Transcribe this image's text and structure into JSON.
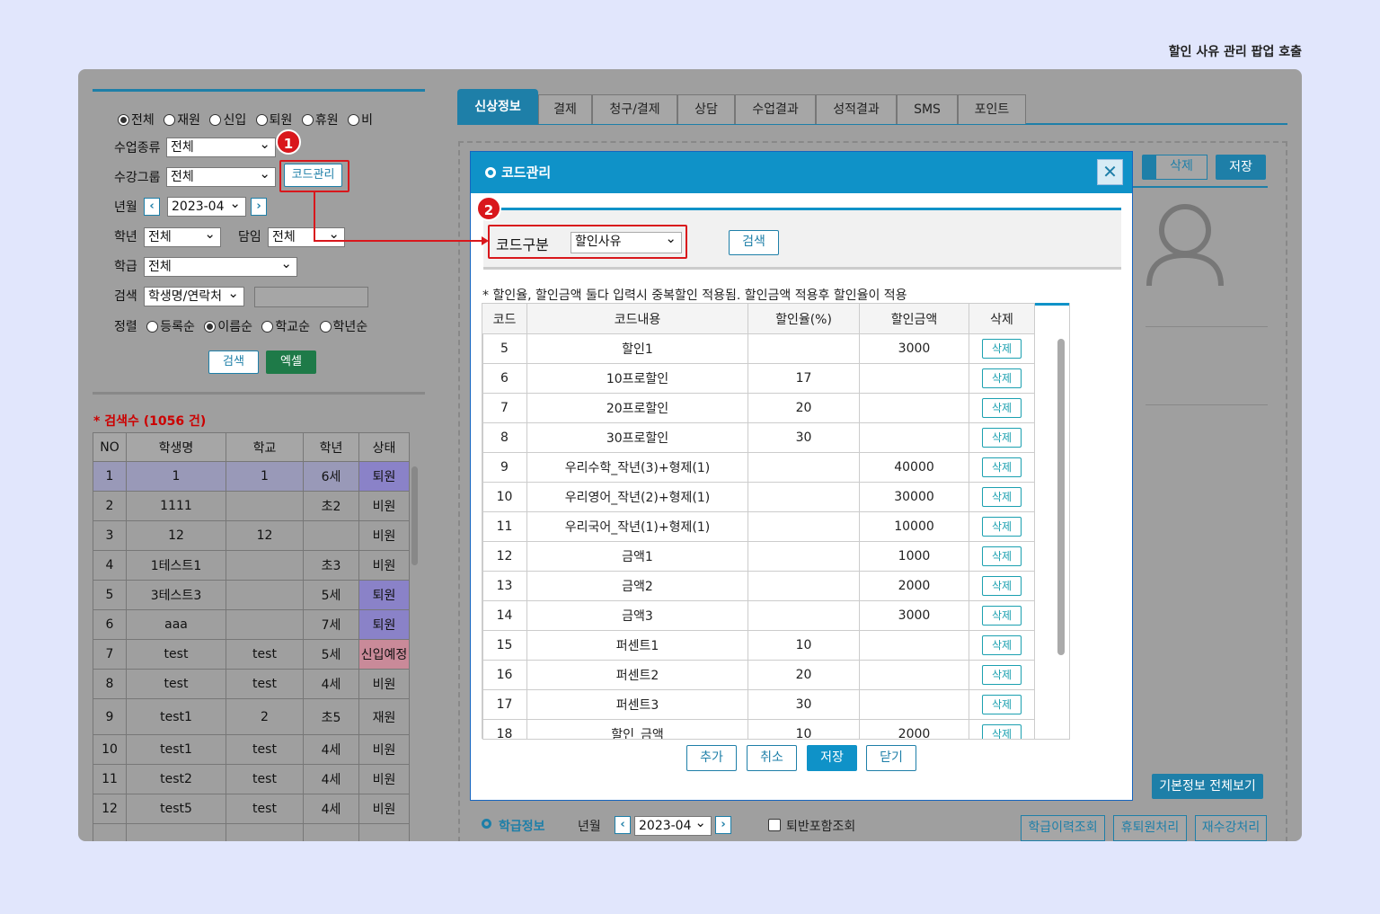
{
  "caption": "할인 사유 관리 팝업 호출",
  "left": {
    "radios": [
      "전체",
      "재원",
      "신입",
      "퇴원",
      "휴원",
      "비"
    ],
    "class_type_label": "수업종류",
    "class_type_value": "전체",
    "group_label": "수강그룹",
    "group_value": "전체",
    "code_btn": "코드관리",
    "ym_label": "년월",
    "ym_value": "2023-04",
    "grade_label": "학년",
    "grade_value": "전체",
    "teacher_label": "담임",
    "teacher_value": "전체",
    "school_label": "학급",
    "school_value": "전체",
    "search_label": "검색",
    "search_type": "학생명/연락처",
    "sort_label": "정렬",
    "sort_opts": [
      "등록순",
      "이름순",
      "학교순",
      "학년순"
    ],
    "search_btn": "검색",
    "excel_btn": "엑셀",
    "count": "* 검색수 (1056 건)",
    "headers": [
      "NO",
      "학생명",
      "학교",
      "학년",
      "상태"
    ],
    "rows": [
      [
        "1",
        "1",
        "1",
        "6세",
        "퇴원"
      ],
      [
        "2",
        "1111",
        "",
        "초2",
        "비원"
      ],
      [
        "3",
        "12",
        "12",
        "",
        "비원"
      ],
      [
        "4",
        "1테스트1",
        "",
        "초3",
        "비원"
      ],
      [
        "5",
        "3테스트3",
        "",
        "5세",
        "퇴원"
      ],
      [
        "6",
        "aaa",
        "",
        "7세",
        "퇴원"
      ],
      [
        "7",
        "test",
        "test",
        "5세",
        "신입예정"
      ],
      [
        "8",
        "test",
        "test",
        "4세",
        "비원"
      ],
      [
        "9",
        "test1",
        "2",
        "초5",
        "재원"
      ],
      [
        "10",
        "test1",
        "test",
        "4세",
        "비원"
      ],
      [
        "11",
        "test2",
        "test",
        "4세",
        "비원"
      ],
      [
        "12",
        "test5",
        "test",
        "4세",
        "비원"
      ]
    ]
  },
  "tabs": [
    "신상정보",
    "결제",
    "청구/결제",
    "상담",
    "수업결과",
    "성적결과",
    "SMS",
    "포인트"
  ],
  "right": {
    "delete_btn": "삭제",
    "save_btn": "저장",
    "basic_info_btn": "기본정보 전체보기",
    "class_info": "학급정보",
    "ym_label": "년월",
    "ym_value": "2023-04",
    "withdraw_chk": "퇴반포함조회",
    "btn_history": "학급이력조회",
    "btn_leave": "휴퇴원처리",
    "btn_retake": "재수강처리"
  },
  "modal": {
    "title": "코드관리",
    "code_label": "코드구분",
    "code_value": "할인사유",
    "search_btn": "검색",
    "note": "* 할인율, 할인금액 둘다 입력시 중복할인 적용됨. 할인금액 적용후 할인율이 적용",
    "headers": [
      "코드",
      "코드내용",
      "할인율(%)",
      "할인금액",
      "삭제"
    ],
    "del_label": "삭제",
    "rows": [
      [
        "5",
        "할인1",
        "",
        "3000"
      ],
      [
        "6",
        "10프로할인",
        "17",
        ""
      ],
      [
        "7",
        "20프로할인",
        "20",
        ""
      ],
      [
        "8",
        "30프로할인",
        "30",
        ""
      ],
      [
        "9",
        "우리수학_작년(3)+형제(1)",
        "",
        "40000"
      ],
      [
        "10",
        "우리영어_작년(2)+형제(1)",
        "",
        "30000"
      ],
      [
        "11",
        "우리국어_작년(1)+형제(1)",
        "",
        "10000"
      ],
      [
        "12",
        "금액1",
        "",
        "1000"
      ],
      [
        "13",
        "금액2",
        "",
        "2000"
      ],
      [
        "14",
        "금액3",
        "",
        "3000"
      ],
      [
        "15",
        "퍼센트1",
        "10",
        ""
      ],
      [
        "16",
        "퍼센트2",
        "20",
        ""
      ],
      [
        "17",
        "퍼센트3",
        "30",
        ""
      ],
      [
        "18",
        "할인_금액",
        "10",
        "2000"
      ]
    ],
    "btn_add": "추가",
    "btn_cancel": "취소",
    "btn_save": "저장",
    "btn_close": "닫기"
  },
  "badges": [
    "1",
    "2"
  ]
}
